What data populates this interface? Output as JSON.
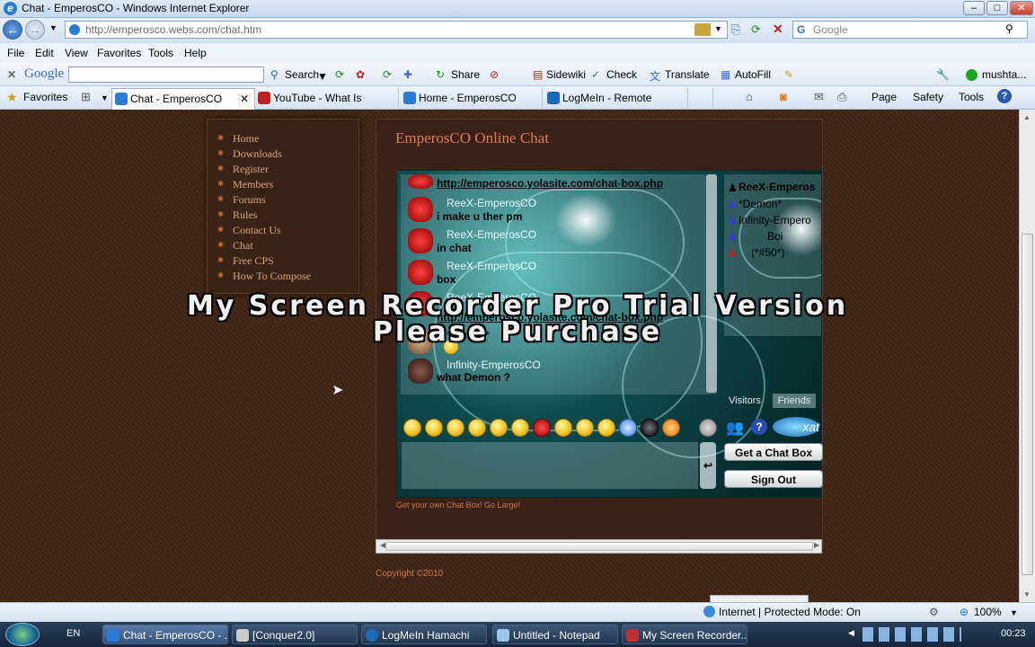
{
  "window": {
    "title": "Chat - EmperosCO - Windows Internet Explorer"
  },
  "address_bar": {
    "url": "http://emperosco.webs.com/chat.htm",
    "search_placeholder": "Google"
  },
  "menu": [
    "File",
    "Edit",
    "View",
    "Favorites",
    "Tools",
    "Help"
  ],
  "google_toolbar": {
    "brand": "Google",
    "search_label": "Search",
    "share_label": "Share",
    "sidewiki_label": "Sidewiki",
    "check_label": "Check",
    "translate_label": "Translate",
    "autofill_label": "AutoFill",
    "user_label": "mushta..."
  },
  "favorites_bar": {
    "favorites_label": "Favorites",
    "tabs": [
      {
        "label": "Chat - EmperosCO"
      },
      {
        "label": "YouTube - What Is LogMeI..."
      },
      {
        "label": "Home - EmperosCO"
      },
      {
        "label": "LogMeIn - Remote Access ..."
      }
    ],
    "page_label": "Page",
    "safety_label": "Safety",
    "tools_label": "Tools"
  },
  "site": {
    "nav": [
      "Home",
      "Downloads",
      "Register",
      "Members",
      "Forums",
      "Rules",
      "Contact Us",
      "Chat",
      "Free CPS",
      "How To Compose"
    ],
    "title": "EmperosCO Online Chat",
    "chat_footer_link": "Get your own Chat Box! Go Large!",
    "copyright": "Copyright ©2010"
  },
  "chat": {
    "top_link": "http://emperosco.yolasite.com/chat-box.php",
    "messages": [
      {
        "user": "ReeX-EmperosCO",
        "text": "i make u ther pm"
      },
      {
        "user": "ReeX-EmperosCO",
        "text": "in chat"
      },
      {
        "user": "ReeX-EmperosCO",
        "text": "box"
      },
      {
        "user": "ReeX-EmperosCO",
        "text": "http://emperosco.yolasite.com/chat-box.php"
      },
      {
        "user": "*Demon*",
        "text": ""
      },
      {
        "user": "Infinity-EmperosCO",
        "text": "what Demon ?"
      }
    ],
    "users": [
      "ReeX-Emperos",
      "*Demon*",
      "Infinity-Empero",
      "Boi",
      "(*#50*)"
    ],
    "tabs": {
      "visitors": "Visitors",
      "friends": "Friends"
    },
    "get_chat_box_label": "Get a Chat Box",
    "sign_out_label": "Sign Out"
  },
  "watermark": {
    "line1": "My Screen Recorder Pro Trial Version",
    "line2": "Please Purchase"
  },
  "status_bar": {
    "zone": "Internet | Protected Mode: On",
    "zoom": "100%"
  },
  "taskbar": {
    "language": "EN",
    "tasks": [
      "Chat - EmperosCO - ...",
      "[Conquer2.0]",
      "LogMeIn Hamachi",
      "Untitled - Notepad",
      "My Screen Recorder..."
    ],
    "clock": "00:23"
  },
  "colors": {
    "site_background": "#43271a",
    "nav_text": "#d9a57a",
    "title_text": "#d97e4f",
    "chat_teal": "#0f4b4e"
  }
}
